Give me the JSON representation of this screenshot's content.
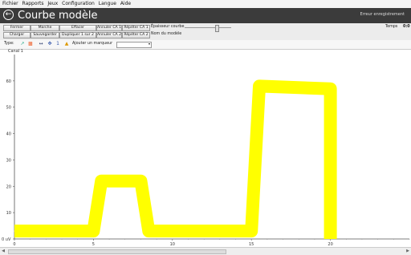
{
  "menu": [
    "Fichier",
    "Rapports",
    "Jeux",
    "Configuration",
    "Langue",
    "Aide"
  ],
  "title": "Courbe modèle",
  "error_text": "Erreur enregistrement",
  "temps_label": "Temps",
  "temps_value": "0:0",
  "buttons_row1": [
    "Fermer",
    "Marche",
    "Effacer",
    "Annuler CA 1",
    "Répéter CA 1"
  ],
  "buttons_row2": [
    "Charger",
    "Sauvegarder",
    "Dupliquer 1 sur 2",
    "Annuler CA 2",
    "Répéter CA 2"
  ],
  "epaisseur_label": "Épaisseur courbe",
  "nom_label": "Nom du modèle",
  "type_label": "Type:",
  "marker_label": "Ajouter un marqueur",
  "canal_label": "Canal 1",
  "chart_data": {
    "type": "line",
    "series": [
      {
        "x": [
          0,
          5,
          5.5,
          8,
          8.5,
          15,
          15.5,
          20,
          20
        ],
        "y": [
          3,
          3,
          22,
          22,
          3,
          3,
          58,
          57,
          0
        ]
      }
    ],
    "xticks": [
      0,
      5,
      10,
      15,
      20
    ],
    "yticks": [
      0,
      10,
      20,
      30,
      40,
      50,
      60
    ],
    "xlim": [
      0,
      25
    ],
    "ylim": [
      0,
      70
    ],
    "ylabel": "0 uV",
    "color": "#ffff00"
  }
}
